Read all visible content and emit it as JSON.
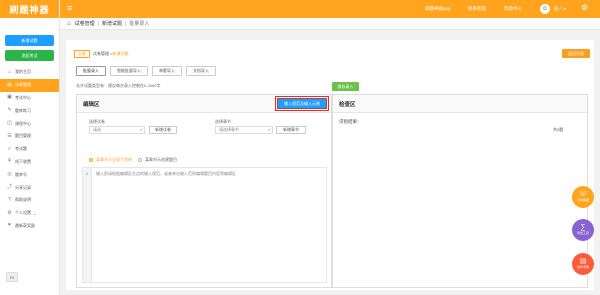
{
  "app": {
    "logo": "刷题神器"
  },
  "sidebar": {
    "new_paper": "新增试题",
    "exam": "发起考试",
    "items": [
      {
        "label": "我的主页",
        "icon": "home-icon",
        "glyph": "⌂"
      },
      {
        "label": "试卷管理",
        "icon": "paper-icon",
        "glyph": "▤",
        "active": true
      },
      {
        "label": "考试中心",
        "icon": "exam-icon",
        "glyph": "▣"
      },
      {
        "label": "题库练习",
        "icon": "practice-icon",
        "glyph": "✎"
      },
      {
        "label": "课程中心",
        "icon": "course-icon",
        "glyph": "◫"
      },
      {
        "label": "题目管理",
        "icon": "manage-icon",
        "glyph": "☰"
      },
      {
        "label": "考试题",
        "icon": "test-icon",
        "glyph": "✓"
      },
      {
        "label": "线下收费",
        "icon": "fee-icon",
        "glyph": "¥"
      },
      {
        "label": "题库号",
        "icon": "bank-icon",
        "glyph": "◎"
      },
      {
        "label": "分享记录",
        "icon": "share-icon",
        "glyph": "⤴"
      },
      {
        "label": "帮助说明",
        "icon": "help-icon",
        "glyph": "?"
      },
      {
        "label": "个人设置",
        "icon": "settings-icon",
        "glyph": "⚙",
        "caret": "⌄"
      },
      {
        "label": "邀新获奖励",
        "icon": "invite-icon",
        "glyph": "♥"
      }
    ],
    "bottom_label": "Ri"
  },
  "topbar": {
    "links": [
      "刷题神器app",
      "联系客服",
      "帮助中心"
    ],
    "username": "赵八",
    "user_caret": "▾",
    "avatar_glyph": "☺",
    "gear_glyph": "⚙",
    "menu_glyph": "≡"
  },
  "breadcrumb": {
    "home_glyph": "⌂",
    "items": [
      "试卷管理",
      "新增试题",
      "批量录入"
    ]
  },
  "card": {
    "sub_tag": "出卷",
    "sub_path": "试卷管理 >",
    "sub_current": "新增试题",
    "back_label": "返回列表",
    "tabs": [
      "批量录入",
      "智能批量导入",
      "单题导入",
      "文档导入"
    ],
    "hint": "允许试题类型有：建议每次录入控制在0-2000字",
    "green_btn": "保存录入"
  },
  "edit_panel": {
    "title": "编辑区",
    "sample_btn": "输入规范及输入示例",
    "paper_label": "选择试卷",
    "paper_value": "请选",
    "paper_btn": "新增试卷",
    "chapter_label": "选择章节",
    "chapter_placeholder": "请选择章节",
    "chapter_btn": "新增章节",
    "radio_on": "某章节示全部下划线",
    "radio_off": "某章节示创建题目",
    "gutter_num": "1",
    "placeholder": "输入即请根据编辑区左边的输入规范，或者单击输入范例编辑题目内容到编辑区"
  },
  "check_panel": {
    "title": "检查区",
    "result_label": "识别结果：",
    "count": "共0题"
  },
  "fabs": [
    {
      "label": "在线客服",
      "glyph": "☏",
      "icon": "support-icon"
    },
    {
      "label": "导出工具",
      "glyph": "∑",
      "icon": "export-icon"
    },
    {
      "label": "操作手册",
      "glyph": "▤",
      "icon": "manual-icon"
    }
  ],
  "colors": {
    "brand": "#ffa41c",
    "primary": "#1e9fff",
    "success": "#2bb44a",
    "highlight": "#e0302a"
  }
}
